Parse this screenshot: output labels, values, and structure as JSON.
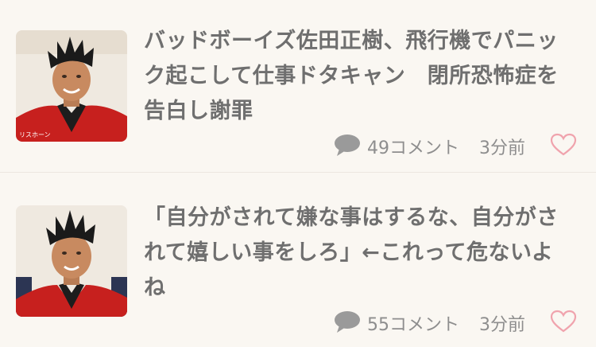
{
  "articles": [
    {
      "title": "バッドボーイズ佐田正樹、飛行機でパニック起こして仕事ドタキャン　閉所恐怖症を告白し謝罪",
      "comment_count": "49コメント",
      "time_ago": "3分前",
      "thumb_credit": "リスホーン",
      "thumb_icon": "person-red-jacket-photo"
    },
    {
      "title": "「自分がされて嫌な事はするな、自分がされて嬉しい事をしろ」←これって危ないよね",
      "comment_count": "55コメント",
      "time_ago": "3分前",
      "thumb_icon": "person-red-jacket-photo"
    }
  ],
  "colors": {
    "background": "#faf7f2",
    "title_text": "#6f6f6f",
    "meta_text": "#8e8e8e",
    "comment_icon": "#9a9a9a",
    "heart_icon": "#f0a3ad",
    "divider": "#ece7e0"
  },
  "icons": {
    "comment": "speech-bubble-icon",
    "like": "heart-outline-icon"
  }
}
